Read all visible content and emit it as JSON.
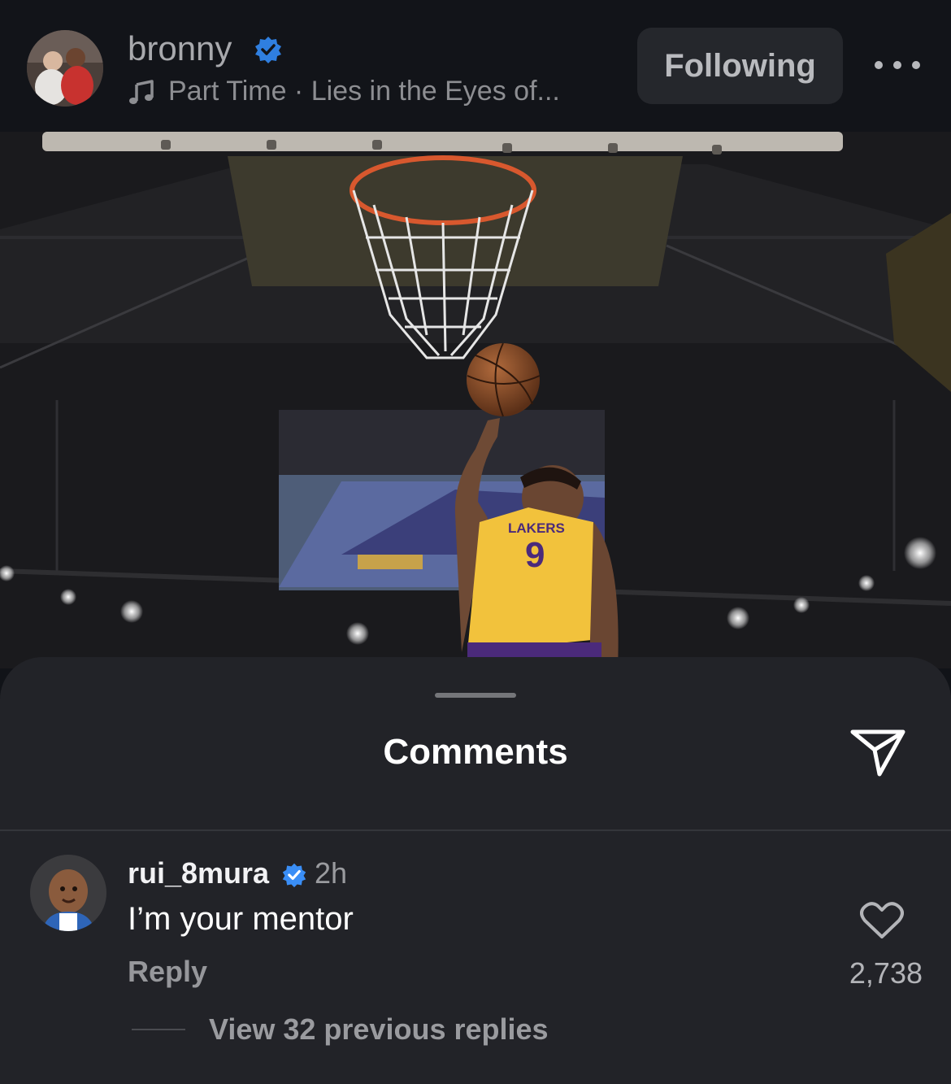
{
  "header": {
    "username": "bronny",
    "music_text": "Part Time · Lies in the Eyes of...",
    "follow_label": "Following"
  },
  "comments_sheet": {
    "title": "Comments"
  },
  "comment": {
    "username": "rui_8mura",
    "time": "2h",
    "text": "I’m your mentor",
    "reply_label": "Reply",
    "like_count": "2,738",
    "view_replies": "View 32 previous replies"
  },
  "photo": {
    "jersey_number": "9",
    "jersey_text": "LAKERS"
  },
  "colors": {
    "verified_blue": "#2f89f5",
    "lakers_gold": "#f2c23c",
    "lakers_purple": "#4b2a7b",
    "sheet_bg": "#222328"
  },
  "icons": [
    "verified-badge-icon",
    "music-note-icon",
    "more-dots-icon",
    "send-icon",
    "heart-icon"
  ]
}
